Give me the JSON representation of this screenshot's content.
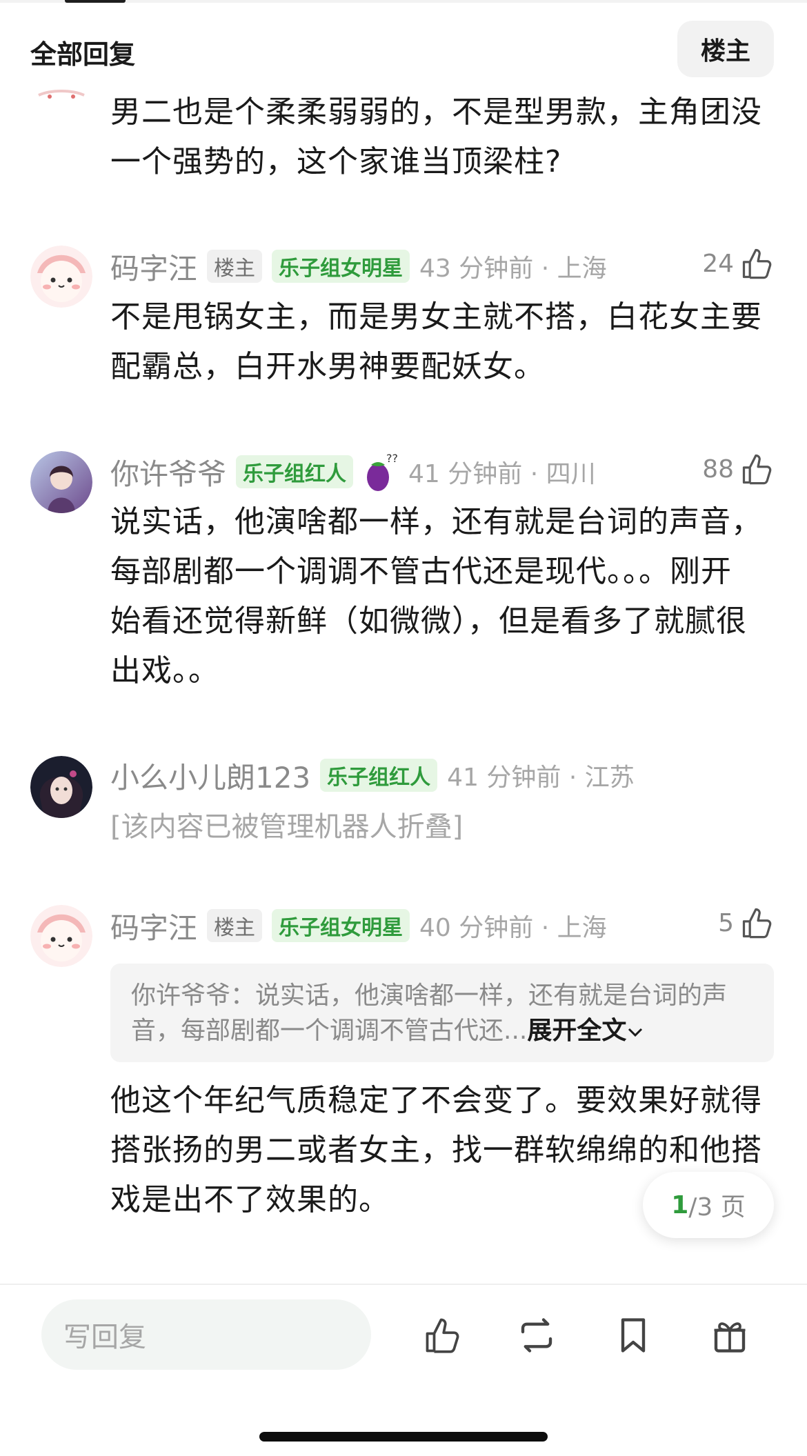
{
  "header": {
    "title": "全部回复",
    "louzhu_button": "楼主"
  },
  "comments": [
    {
      "content": "男二也是个柔柔弱弱的，不是型男款，主角团没一个强势的，这个家谁当顶梁柱?"
    },
    {
      "name": "码字汪",
      "tag_gray": "楼主",
      "tag_green": "乐子组女明星",
      "meta": "43 分钟前 · 上海",
      "likes": "24",
      "content": "不是甩锅女主，而是男女主就不搭，白花女主要配霸总，白开水男神要配妖女。"
    },
    {
      "name": "你许爷爷",
      "tag_green": "乐子组红人",
      "meta": "41 分钟前 · 四川",
      "likes": "88",
      "content": "说实话，他演啥都一样，还有就是台词的声音，每部剧都一个调调不管古代还是现代。。。刚开始看还觉得新鲜（如微微），但是看多了就腻很出戏。。"
    },
    {
      "name": "小么小儿朗123",
      "tag_green": "乐子组红人",
      "meta": "41 分钟前 · 江苏",
      "folded": "[该内容已被管理机器人折叠]"
    },
    {
      "name": "码字汪",
      "tag_gray": "楼主",
      "tag_green": "乐子组女明星",
      "meta": "40 分钟前 · 上海",
      "likes": "5",
      "quote": "你许爷爷：说实话，他演啥都一样，还有就是台词的声音，每部剧都一个调调不管古代还...",
      "quote_expand": "展开全文",
      "content": "他这个年纪气质稳定了不会变了。要效果好就得搭张扬的男二或者女主，找一群软绵绵的和他搭戏是出不了效果的。"
    }
  ],
  "pager": {
    "current": "1",
    "total_suffix": "/3 页"
  },
  "bottom_bar": {
    "reply_placeholder": "写回复"
  },
  "colors": {
    "accent_green": "#2f9b3c",
    "tag_green_bg": "#e6f6e4",
    "muted_text": "#a6a6a6"
  }
}
